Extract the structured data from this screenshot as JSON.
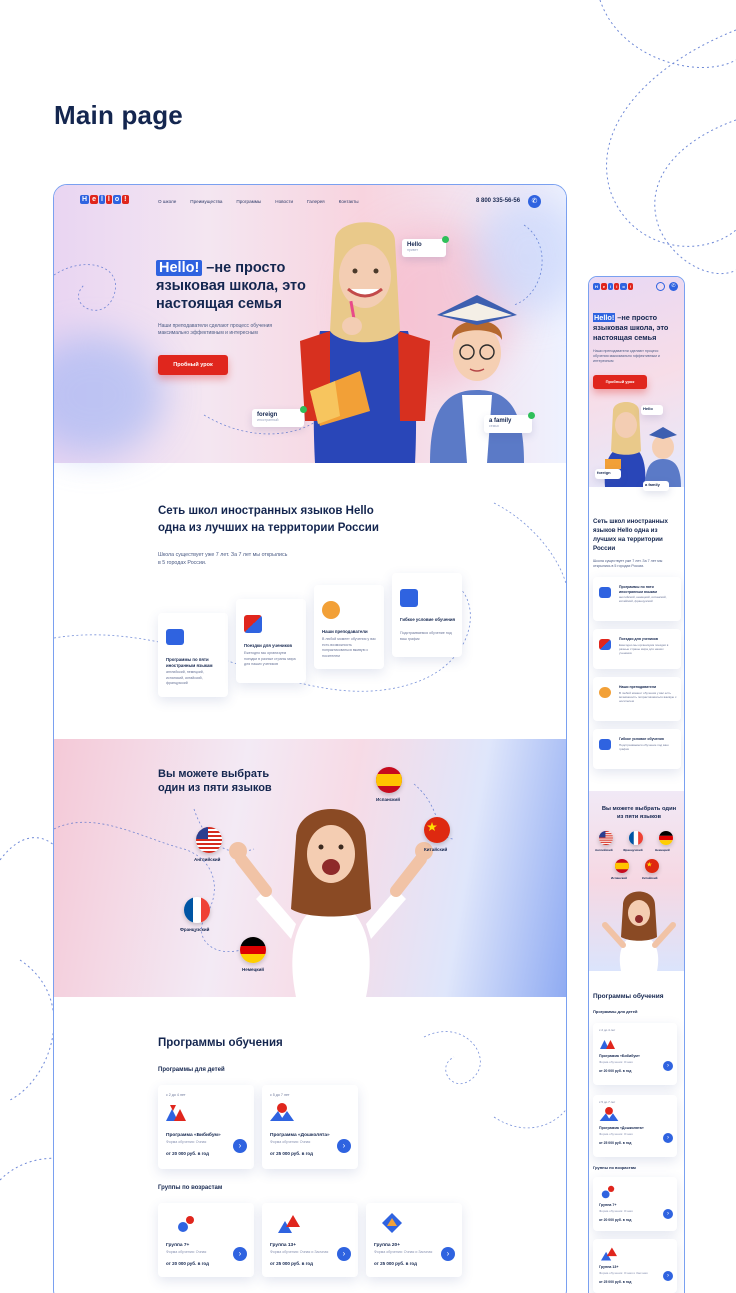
{
  "page_title": "Main page",
  "colors": {
    "accent": "#2f63e0",
    "cta": "#e0261d",
    "text": "#14264f",
    "frame": "#7aa0f0"
  },
  "logo": {
    "letters": [
      "H",
      "e",
      "l",
      "l",
      "o",
      "!"
    ]
  },
  "nav": {
    "links": [
      "О школе",
      "Преимущества",
      "Программы",
      "Новости",
      "Галерея",
      "Контакты"
    ],
    "phone": "8 800 335-56-56",
    "call_icon": "phone-icon"
  },
  "hero": {
    "highlight": "Hello!",
    "title_rest": " –не просто языковая школа, это настоящая семья",
    "subtitle": "Наши преподаватели сделают процесс обучения максимально эффективным и интересным",
    "cta": "Пробный урок",
    "bubbles": [
      {
        "word": "Hello",
        "sub": "привет"
      },
      {
        "word": "foreign",
        "sub": "иностранный"
      },
      {
        "word": "a family",
        "sub": "семья"
      }
    ]
  },
  "about": {
    "title": "Сеть школ иностранных языков Hello одна из лучших на территории России",
    "text": "Школа существует уже 7 лет. За 7 лет мы открылись в 5 городах России.",
    "cards": [
      {
        "title": "Программы по пяти иностранным языкам",
        "text": "английский, немецкий, испанский, китайский, французский",
        "icon": "languages-icon"
      },
      {
        "title": "Поездки для учеников",
        "text": "Ежегодно мы организуем поездки в разные страны мира для наших учеников",
        "icon": "travel-icon"
      },
      {
        "title": "Наши преподаватели",
        "text": "В любой момент обучения у вас есть возможность попрактиковаться вживую с носителем",
        "icon": "teacher-icon"
      },
      {
        "title": "Гибкое условие обучения",
        "text": "Подстраиваемся обучение под ваш график",
        "icon": "calendar-icon"
      }
    ]
  },
  "languages": {
    "title": "Вы можете выбрать один из пяти языков",
    "items": [
      {
        "name": "Английский",
        "flag": "usa-flag"
      },
      {
        "name": "Испанский",
        "flag": "spain-flag"
      },
      {
        "name": "Китайский",
        "flag": "china-flag"
      },
      {
        "name": "Французский",
        "flag": "france-flag"
      },
      {
        "name": "Немецкий",
        "flag": "germany-flag"
      }
    ]
  },
  "programs": {
    "title": "Программы обучения",
    "kids_title": "Программы для детей",
    "kids": [
      {
        "age": "с 2 до 4 лет",
        "name": "Программа «Бибибум»",
        "form": "Форма обучения: Очная",
        "price": "от 20 000 руб. в год"
      },
      {
        "age": "с 5 до 7 лет",
        "name": "Программа «Дошколята»",
        "form": "Форма обучения: Очная",
        "price": "от 25 000 руб. в год"
      }
    ],
    "age_title": "Группы по возрастам",
    "groups": [
      {
        "name": "Группа 7+",
        "form": "Форма обучения: Очная",
        "price": "от 20 000 руб. в год"
      },
      {
        "name": "Группа 13+",
        "form": "Форма обучения: Очная и Заочная",
        "price": "от 25 000 руб. в год"
      },
      {
        "name": "Группа 20+",
        "form": "Форма обучения: Очная и Заочная",
        "price": "от 25 000 руб. в год"
      }
    ]
  },
  "mobile": {
    "hero_title_rest": " –не просто языковая школа, это настоящая семья",
    "about_title": "Сеть школ иностранных языков Hello одна из лучших на территории России",
    "lang_title": "Вы можете выбрать один из пяти языков"
  }
}
